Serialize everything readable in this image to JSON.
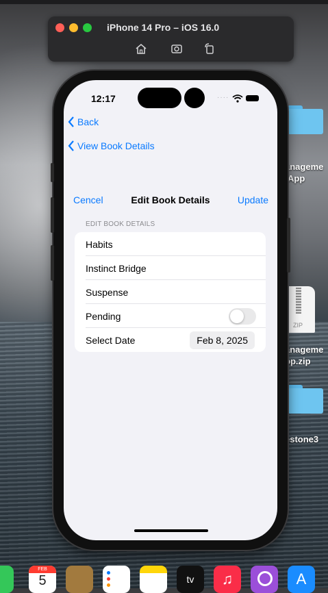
{
  "simulator": {
    "title": "iPhone 14 Pro – iOS 16.0",
    "toolbar_icons": [
      "home-icon",
      "screenshot-icon",
      "rotate-icon"
    ]
  },
  "desktop": {
    "items": [
      {
        "label_line1": "anageme",
        "label_line2": "App"
      },
      {
        "label_line1": "anageme",
        "label_line2": "pp.zip",
        "file_badge": "ZIP"
      },
      {
        "label_line1": "estone3"
      }
    ]
  },
  "status_bar": {
    "time": "12:17"
  },
  "navigation": {
    "back_label": "Back",
    "back2_label": "View Book Details"
  },
  "sheet": {
    "cancel_label": "Cencel",
    "title": "Edit Book Details",
    "update_label": "Update",
    "section_header": "EDIT BOOK DETAILS",
    "fields": {
      "title": "Habits",
      "author": "Instinct Bridge",
      "genre": "Suspense",
      "status_label": "Pending",
      "status_on": false,
      "date_label": "Select Date",
      "date_value": "Feb 8, 2025"
    }
  },
  "dock": {
    "calendar_month": "FEB",
    "calendar_day": "5",
    "tv_label": "tv"
  },
  "colors": {
    "accent": "#0a7aff",
    "background": "#f2f2f7"
  }
}
